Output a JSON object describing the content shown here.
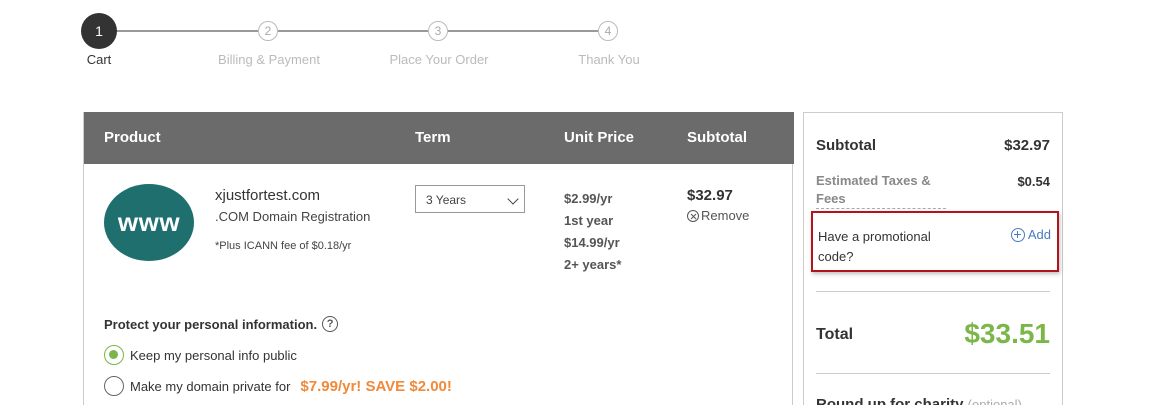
{
  "stepper": {
    "steps": [
      {
        "number": "1",
        "label": "Cart",
        "active": true
      },
      {
        "number": "2",
        "label": "Billing & Payment",
        "active": false
      },
      {
        "number": "3",
        "label": "Place Your Order",
        "active": false
      },
      {
        "number": "4",
        "label": "Thank You",
        "active": false
      }
    ]
  },
  "cart": {
    "headers": {
      "product": "Product",
      "term": "Term",
      "unit_price": "Unit Price",
      "subtotal": "Subtotal"
    },
    "item": {
      "icon_text": "www",
      "domain": "xjustfortest.com",
      "type": ".COM Domain Registration",
      "fee_note": "*Plus ICANN fee of $0.18/yr",
      "term": "3 Years",
      "unit_price_lines": [
        "$2.99/yr",
        "1st year",
        "$14.99/yr",
        "2+ years*"
      ],
      "subtotal": "$32.97",
      "remove_label": "Remove"
    },
    "privacy": {
      "title": "Protect your personal information.",
      "help_glyph": "?",
      "option_public": "Keep my personal info public",
      "option_private": "Make my domain private for",
      "private_price": "$7.99/yr! SAVE $2.00!",
      "selected": "public"
    }
  },
  "summary": {
    "subtotal_label": "Subtotal",
    "subtotal_value": "$32.97",
    "tax_label": "Estimated Taxes & Fees",
    "tax_value": "$0.54",
    "promo_text": "Have a promotional code?",
    "promo_add": "Add",
    "total_label": "Total",
    "total_value": "$33.51",
    "charity_label": "Round up for charity",
    "charity_optional": "(optional)"
  },
  "colors": {
    "accent_green": "#7ab648",
    "link_blue": "#4a7bbf",
    "highlight_red": "#b0151d",
    "orange": "#f08a3a",
    "header_gray": "#6b6b6b"
  }
}
